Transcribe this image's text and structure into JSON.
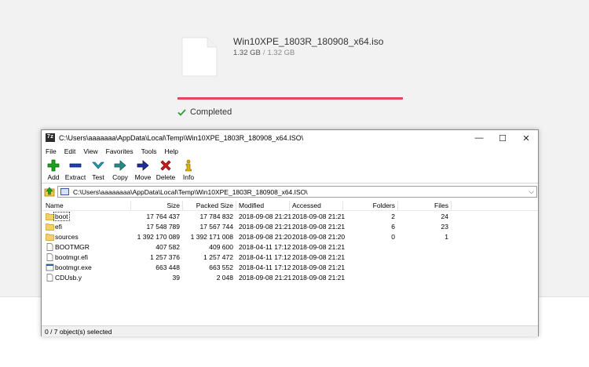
{
  "download": {
    "file_name": "Win10XPE_1803R_180908_x64.iso",
    "size_done": "1.32 GB",
    "size_sep": "/",
    "size_total": "1.32 GB",
    "progress": 1.0,
    "status": "Completed",
    "accent_color": "#e2485a",
    "check_color": "#2e9a3a"
  },
  "window": {
    "title": "C:\\Users\\aaaaaaa\\AppData\\Local\\Temp\\Win10XPE_1803R_180908_x64.ISO\\",
    "app_icon_text": "7z",
    "controls": {
      "minimize": "—",
      "maximize": "☐",
      "close": "✕"
    }
  },
  "menu": [
    "File",
    "Edit",
    "View",
    "Favorites",
    "Tools",
    "Help"
  ],
  "toolbar": [
    {
      "label": "Add",
      "icon": "add-icon"
    },
    {
      "label": "Extract",
      "icon": "extract-icon"
    },
    {
      "label": "Test",
      "icon": "test-icon"
    },
    {
      "label": "Copy",
      "icon": "copy-icon"
    },
    {
      "label": "Move",
      "icon": "move-icon"
    },
    {
      "label": "Delete",
      "icon": "delete-icon"
    },
    {
      "label": "Info",
      "icon": "info-icon"
    }
  ],
  "address": {
    "path": "C:\\Users\\aaaaaaaa\\AppData\\Local\\Temp\\Win10XPE_1803R_180908_x64.ISO\\"
  },
  "columns": [
    "Name",
    "Size",
    "Packed Size",
    "Modified",
    "Accessed",
    "Folders",
    "Files"
  ],
  "rows": [
    {
      "type": "folder",
      "name": "boot",
      "size": "17 764 437",
      "packed": "17 784 832",
      "modified": "2018-09-08 21:21",
      "accessed": "2018-09-08 21:21",
      "folders": "2",
      "files": "24"
    },
    {
      "type": "folder",
      "name": "efi",
      "size": "17 548 789",
      "packed": "17 567 744",
      "modified": "2018-09-08 21:21",
      "accessed": "2018-09-08 21:21",
      "folders": "6",
      "files": "23"
    },
    {
      "type": "folder",
      "name": "sources",
      "size": "1 392 170 089",
      "packed": "1 392 171 008",
      "modified": "2018-09-08 21:20",
      "accessed": "2018-09-08 21:20",
      "folders": "0",
      "files": "1"
    },
    {
      "type": "file",
      "name": "BOOTMGR",
      "size": "407 582",
      "packed": "409 600",
      "modified": "2018-04-11 17:12",
      "accessed": "2018-09-08 21:21",
      "folders": "",
      "files": ""
    },
    {
      "type": "file",
      "name": "bootmgr.efi",
      "size": "1 257 376",
      "packed": "1 257 472",
      "modified": "2018-04-11 17:12",
      "accessed": "2018-09-08 21:21",
      "folders": "",
      "files": ""
    },
    {
      "type": "exe",
      "name": "bootmgr.exe",
      "size": "663 448",
      "packed": "663 552",
      "modified": "2018-04-11 17:12",
      "accessed": "2018-09-08 21:21",
      "folders": "",
      "files": ""
    },
    {
      "type": "file",
      "name": "CDUsb.y",
      "size": "39",
      "packed": "2 048",
      "modified": "2018-09-08 21:21",
      "accessed": "2018-09-08 21:21",
      "folders": "",
      "files": ""
    }
  ],
  "statusbar": {
    "text": "0 / 7 object(s) selected"
  }
}
